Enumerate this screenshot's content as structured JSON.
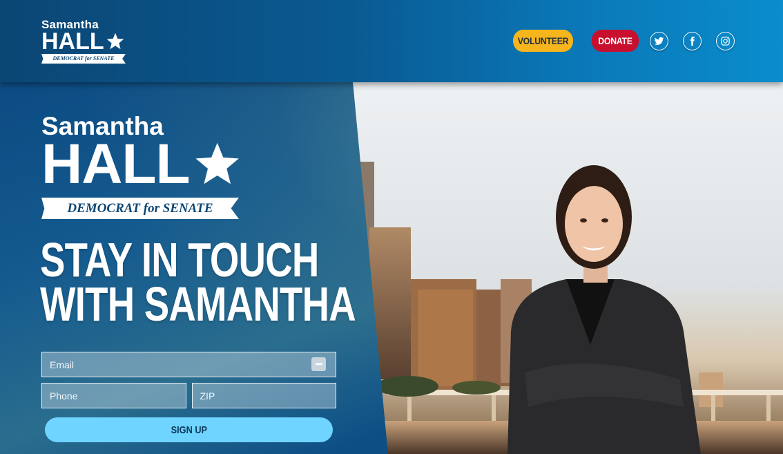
{
  "header": {
    "logo": {
      "first_name": "Samantha",
      "last_name": "HALL",
      "tagline": "DEMOCRAT for SENATE"
    },
    "nav": {
      "volunteer_label": "VOLUNTEER",
      "donate_label": "DONATE"
    },
    "social": [
      {
        "icon": "twitter-icon"
      },
      {
        "icon": "facebook-icon"
      },
      {
        "icon": "instagram-icon"
      }
    ]
  },
  "hero": {
    "logo": {
      "first_name": "Samantha",
      "last_name": "HALL",
      "tagline": "DEMOCRAT for SENATE"
    },
    "headline_line1": "STAY IN TOUCH",
    "headline_line2": "WITH SAMANTHA",
    "form": {
      "email_placeholder": "Email",
      "phone_placeholder": "Phone",
      "zip_placeholder": "ZIP",
      "submit_label": "SIGN UP"
    }
  },
  "colors": {
    "brand_navy": "#0b4674",
    "volunteer_yellow": "#f6b51d",
    "donate_red": "#c8102e",
    "signup_cyan": "#6fd4ff"
  }
}
